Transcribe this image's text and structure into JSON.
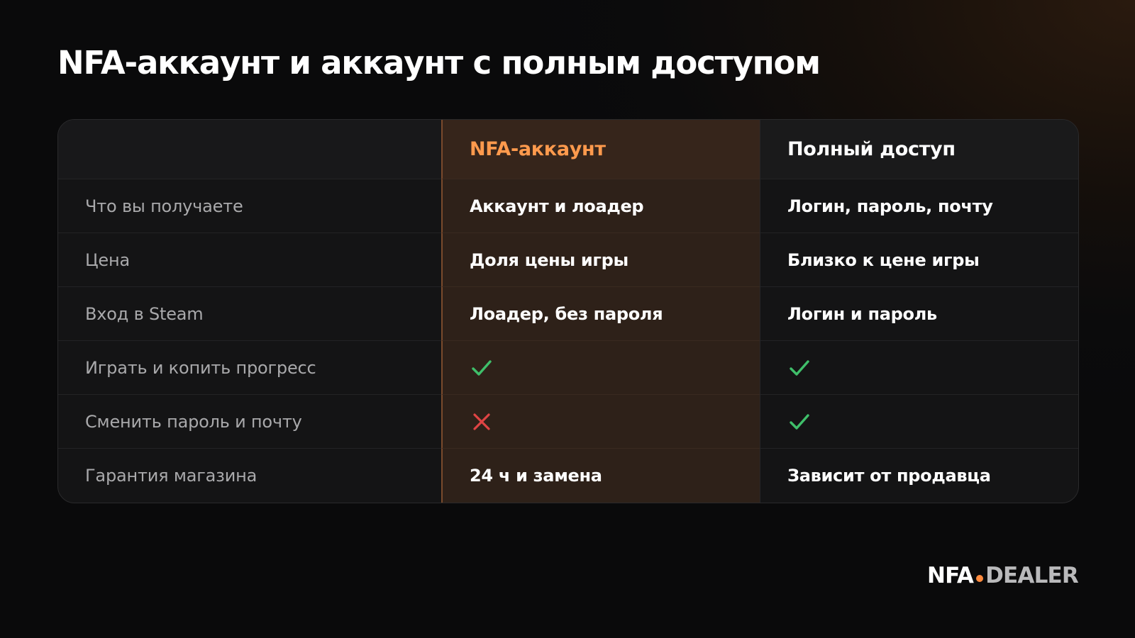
{
  "title": "NFA-аккаунт и аккаунт с полным доступом",
  "table": {
    "columns": [
      "",
      "NFA-аккаунт",
      "Полный доступ"
    ],
    "rows": [
      {
        "label": "Что вы получаете",
        "nfa": {
          "text": "Аккаунт и лоадер"
        },
        "full": {
          "text": "Логин, пароль, почту"
        }
      },
      {
        "label": "Цена",
        "nfa": {
          "text": "Доля цены игры"
        },
        "full": {
          "text": "Близко к цене игры"
        }
      },
      {
        "label": "Вход в Steam",
        "nfa": {
          "text": "Лоадер, без пароля"
        },
        "full": {
          "text": "Логин и пароль"
        }
      },
      {
        "label": "Играть и копить прогресс",
        "nfa": {
          "icon": "check-icon"
        },
        "full": {
          "icon": "check-icon"
        }
      },
      {
        "label": "Сменить пароль и почту",
        "nfa": {
          "icon": "cross-icon"
        },
        "full": {
          "icon": "check-icon"
        }
      },
      {
        "label": "Гарантия магазина",
        "nfa": {
          "text": "24 ч и замена"
        },
        "full": {
          "text": "Зависит от продавца"
        }
      }
    ]
  },
  "logo": {
    "part1": "NFA",
    "part2": "DEALER"
  },
  "colors": {
    "accent": "#ff9a4d",
    "check": "#3fbf6a",
    "cross": "#e04444",
    "nfa_column_bg": "#2e2119",
    "background": "#0b0b0c"
  }
}
